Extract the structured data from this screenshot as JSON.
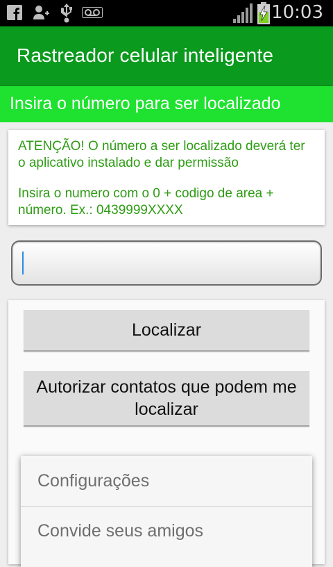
{
  "status_bar": {
    "time": "10:03",
    "icons": [
      "facebook-icon",
      "person-add-icon",
      "usb-icon",
      "voicemail-icon",
      "signal-icon",
      "battery-charging-icon"
    ]
  },
  "app": {
    "title": "Rastreador celular inteligente"
  },
  "subheader": {
    "text": "Insira o número para ser localizado"
  },
  "notice": {
    "warning": "ATENÇÃO! O número a ser localizado deverá ter o aplicativo instalado e dar permissão",
    "instruction": "Insira o numero com o 0 + codigo de area + número. Ex.: 0439999XXXX"
  },
  "phone_input": {
    "value": "",
    "placeholder": ""
  },
  "buttons": {
    "locate": "Localizar",
    "authorize": "Autorizar contatos que podem me localizar"
  },
  "menu": {
    "items": [
      "Configurações",
      "Convide seus amigos"
    ]
  },
  "colors": {
    "action_bar": "#0a9a1d",
    "subheader": "#1ee22f",
    "notice_text": "#2e9c14"
  }
}
